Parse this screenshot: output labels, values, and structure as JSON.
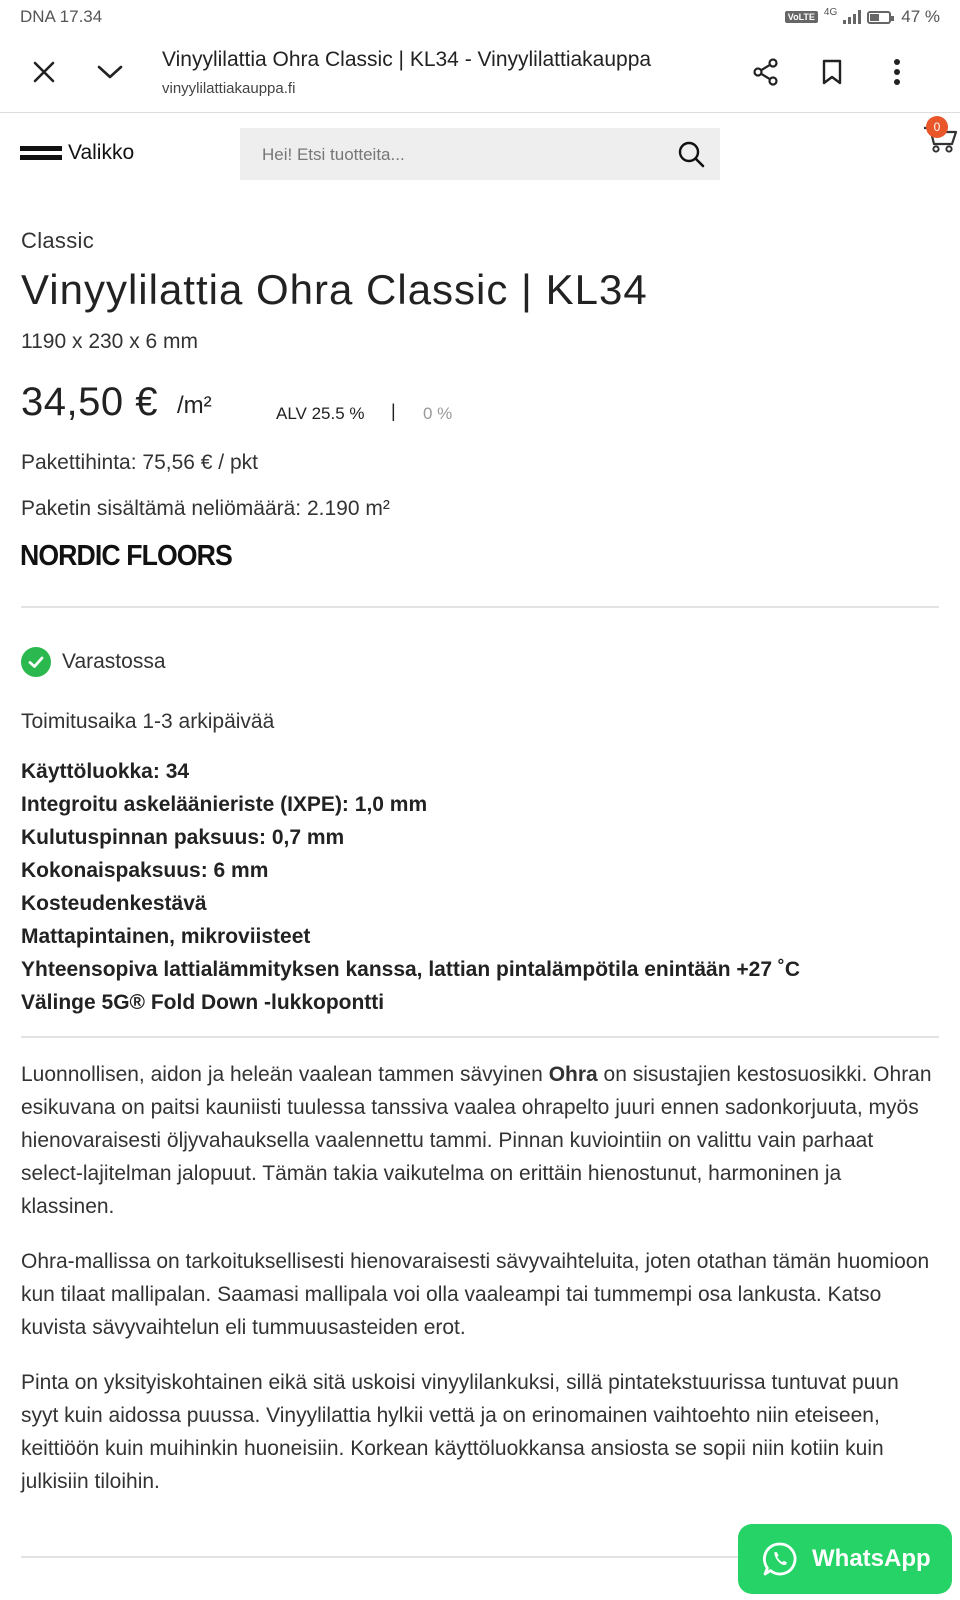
{
  "status_bar": {
    "carrier_time": "DNA 17.34",
    "volte": "VoLTE",
    "network": "4G",
    "battery": "47 %"
  },
  "browser": {
    "title": "Vinyylilattia Ohra Classic | KL34 - Vinyylilattiakauppa",
    "url": "vinyylilattiakauppa.fi",
    "icons": [
      "close-icon",
      "chevron-down-icon",
      "share-icon",
      "bookmark-icon",
      "more-vert-icon"
    ]
  },
  "header": {
    "menu_label": "Valikko",
    "search_placeholder": "Hei! Etsi tuotteita...",
    "cart_count": "0"
  },
  "product": {
    "category": "Classic",
    "title": "Vinyylilattia Ohra Classic | KL34",
    "dimensions": "1190 x 230 x 6 mm",
    "price": "34,50 €",
    "price_unit": "/m²",
    "vat_label": "ALV 25.5 %",
    "vat_separator": "|",
    "vat_zero": "0 %",
    "package_price": "Pakettihinta: 75,56 € / pkt",
    "package_area": "Paketin sisältämä neliömäärä: 2.190 m²",
    "brand": "NORDIC FLOORS",
    "stock_status": "Varastossa",
    "delivery_time": "Toimitusaika 1-3 arkipäivää",
    "features": [
      "Käyttöluokka: 34",
      "Integroitu askeläänieriste (IXPE): 1,0 mm",
      "Kulutuspinnan paksuus: 0,7 mm",
      "Kokonaispaksuus: 6 mm",
      "Kosteudenkestävä",
      "Mattapintainen, mikroviisteet",
      "Yhteensopiva lattialämmityksen kanssa, lattian pintalämpötila enintään +27 ˚C",
      "Välinge 5G® Fold Down -lukkopontti"
    ],
    "description": {
      "p1_start": "Luonnollisen, aidon ja heleän vaalean tammen sävyinen ",
      "p1_bold": "Ohra",
      "p1_end": " on sisustajien kestosuosikki. Ohran esikuvana on paitsi kauniisti tuulessa tanssiva vaalea ohrapelto juuri ennen sadonkorjuuta, myös hienovaraisesti öljyvahauksella vaalennettu tammi. Pinnan kuviointiin on valittu vain parhaat select-lajitelman jalopuut. Tämän takia vaikutelma on erittäin hienostunut, harmoninen ja klassinen.",
      "p2": "Ohra-mallissa on tarkoituksellisesti hienovaraisesti sävyvaihteluita, joten otathan tämän huomioon kun tilaat mallipalan. Saamasi mallipala voi olla vaaleampi tai tummempi osa lankusta. Katso kuvista sävyvaihtelun eli tummuusasteiden erot.",
      "p3": "Pinta on yksityiskohtainen eikä sitä uskoisi vinyylilankuksi, sillä pintatekstuurissa tuntuvat puun syyt kuin aidossa puussa. Vinyylilattia hylkii vettä ja on erinomainen vaihtoehto niin eteiseen, keittiöön kuin muihinkin huoneisiin. Korkean käyttöluokkansa ansiosta se sopii niin kotiin kuin julkisiin tiloihin."
    }
  },
  "whatsapp": {
    "label": "WhatsApp"
  },
  "colors": {
    "stock_green": "#2bb84e",
    "whatsapp_green": "#25d366",
    "cart_badge": "#e8562a",
    "search_bg": "#eeeeee"
  }
}
